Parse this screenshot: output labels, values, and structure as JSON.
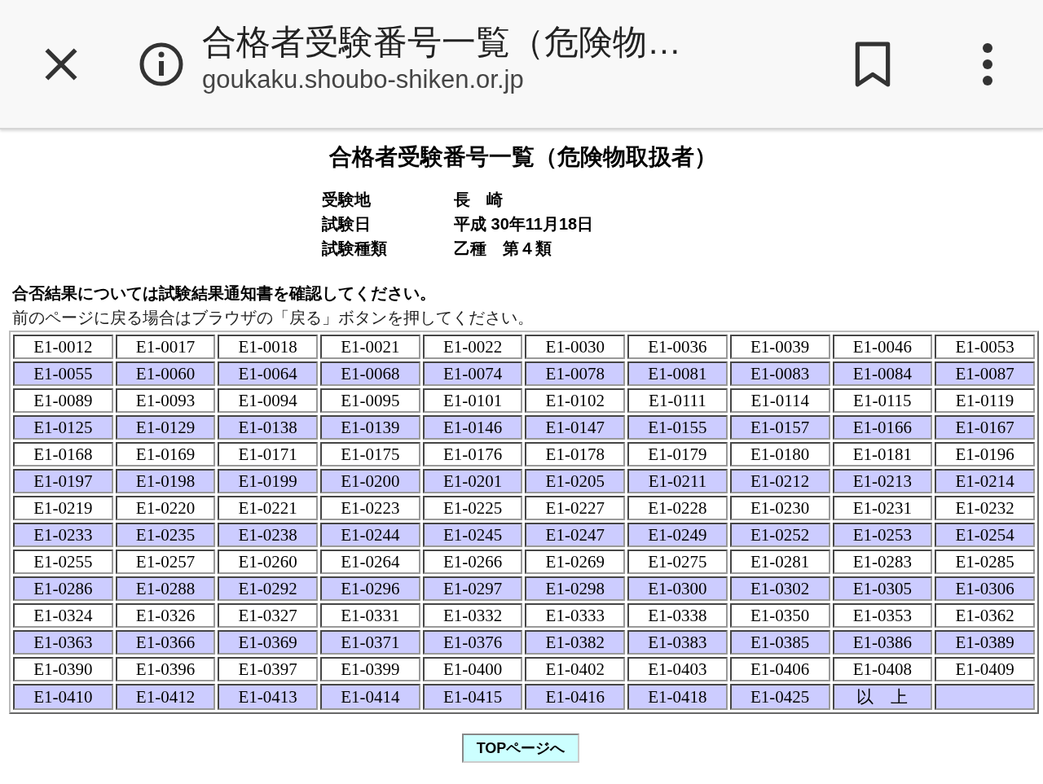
{
  "browser_bar": {
    "title": "合格者受験番号一覧（危険物…",
    "url": "goukaku.shoubo-shiken.or.jp"
  },
  "page": {
    "heading": "合格者受験番号一覧（危険物取扱者）",
    "info": [
      {
        "label": "受験地",
        "value": "長　崎"
      },
      {
        "label": "試験日",
        "value": "平成 30年11月18日"
      },
      {
        "label": "試験種類",
        "value": "乙種　第４類"
      }
    ],
    "notice": "合否結果については試験結果通知書を確認してください。",
    "back_hint": "前のページに戻る場合はブラウザの「戻る」ボタンを押してください。",
    "table": {
      "rows": [
        {
          "shaded": false,
          "cells": [
            "E1-0012",
            "E1-0017",
            "E1-0018",
            "E1-0021",
            "E1-0022",
            "E1-0030",
            "E1-0036",
            "E1-0039",
            "E1-0046",
            "E1-0053"
          ]
        },
        {
          "shaded": true,
          "cells": [
            "E1-0055",
            "E1-0060",
            "E1-0064",
            "E1-0068",
            "E1-0074",
            "E1-0078",
            "E1-0081",
            "E1-0083",
            "E1-0084",
            "E1-0087"
          ]
        },
        {
          "shaded": false,
          "cells": [
            "E1-0089",
            "E1-0093",
            "E1-0094",
            "E1-0095",
            "E1-0101",
            "E1-0102",
            "E1-0111",
            "E1-0114",
            "E1-0115",
            "E1-0119"
          ]
        },
        {
          "shaded": true,
          "cells": [
            "E1-0125",
            "E1-0129",
            "E1-0138",
            "E1-0139",
            "E1-0146",
            "E1-0147",
            "E1-0155",
            "E1-0157",
            "E1-0166",
            "E1-0167"
          ]
        },
        {
          "shaded": false,
          "cells": [
            "E1-0168",
            "E1-0169",
            "E1-0171",
            "E1-0175",
            "E1-0176",
            "E1-0178",
            "E1-0179",
            "E1-0180",
            "E1-0181",
            "E1-0196"
          ]
        },
        {
          "shaded": true,
          "cells": [
            "E1-0197",
            "E1-0198",
            "E1-0199",
            "E1-0200",
            "E1-0201",
            "E1-0205",
            "E1-0211",
            "E1-0212",
            "E1-0213",
            "E1-0214"
          ]
        },
        {
          "shaded": false,
          "cells": [
            "E1-0219",
            "E1-0220",
            "E1-0221",
            "E1-0223",
            "E1-0225",
            "E1-0227",
            "E1-0228",
            "E1-0230",
            "E1-0231",
            "E1-0232"
          ]
        },
        {
          "shaded": true,
          "cells": [
            "E1-0233",
            "E1-0235",
            "E1-0238",
            "E1-0244",
            "E1-0245",
            "E1-0247",
            "E1-0249",
            "E1-0252",
            "E1-0253",
            "E1-0254"
          ]
        },
        {
          "shaded": false,
          "cells": [
            "E1-0255",
            "E1-0257",
            "E1-0260",
            "E1-0264",
            "E1-0266",
            "E1-0269",
            "E1-0275",
            "E1-0281",
            "E1-0283",
            "E1-0285"
          ]
        },
        {
          "shaded": true,
          "cells": [
            "E1-0286",
            "E1-0288",
            "E1-0292",
            "E1-0296",
            "E1-0297",
            "E1-0298",
            "E1-0300",
            "E1-0302",
            "E1-0305",
            "E1-0306"
          ]
        },
        {
          "shaded": false,
          "cells": [
            "E1-0324",
            "E1-0326",
            "E1-0327",
            "E1-0331",
            "E1-0332",
            "E1-0333",
            "E1-0338",
            "E1-0350",
            "E1-0353",
            "E1-0362"
          ]
        },
        {
          "shaded": true,
          "cells": [
            "E1-0363",
            "E1-0366",
            "E1-0369",
            "E1-0371",
            "E1-0376",
            "E1-0382",
            "E1-0383",
            "E1-0385",
            "E1-0386",
            "E1-0389"
          ]
        },
        {
          "shaded": false,
          "cells": [
            "E1-0390",
            "E1-0396",
            "E1-0397",
            "E1-0399",
            "E1-0400",
            "E1-0402",
            "E1-0403",
            "E1-0406",
            "E1-0408",
            "E1-0409"
          ]
        },
        {
          "shaded": true,
          "cells": [
            "E1-0410",
            "E1-0412",
            "E1-0413",
            "E1-0414",
            "E1-0415",
            "E1-0416",
            "E1-0418",
            "E1-0425",
            "以　上",
            null
          ]
        }
      ]
    },
    "top_button": "TOPページへ"
  }
}
